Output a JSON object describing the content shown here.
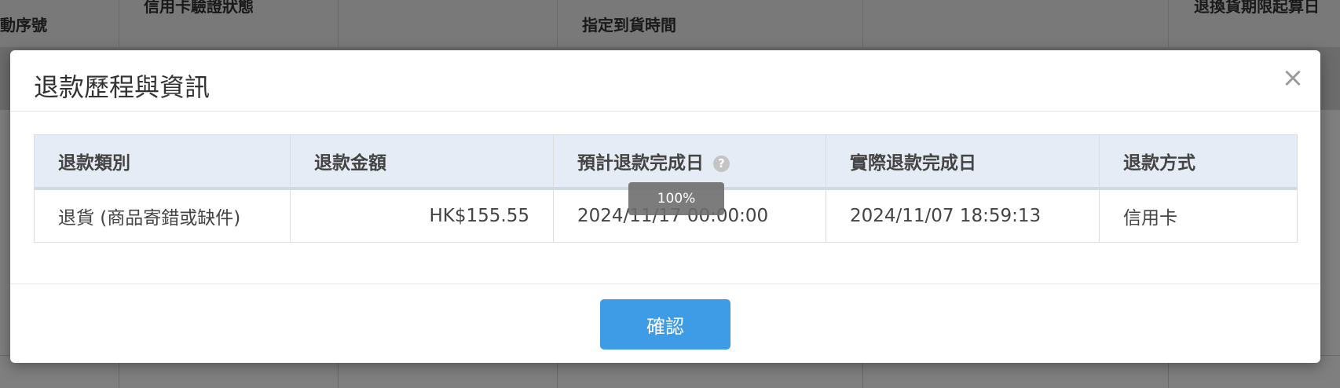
{
  "background": {
    "headers": [
      "動序號",
      "信用卡驗證狀態",
      "",
      "指定到貨時間",
      "",
      "退換貨期限起算日"
    ]
  },
  "modal": {
    "title": "退款歷程與資訊",
    "close_label": "×",
    "table": {
      "columns": [
        "退款類別",
        "退款金額",
        "預計退款完成日",
        "實際退款完成日",
        "退款方式"
      ],
      "rows": [
        {
          "type": "退貨 (商品寄錯或缺件)",
          "amount": "HK$155.55",
          "expected_date": "2024/11/17 00:00:00",
          "actual_date": "2024/11/07 18:59:13",
          "method": "信用卡"
        }
      ]
    },
    "help_icon_glyph": "?",
    "zoom_indicator": "100%",
    "confirm_label": "確認"
  },
  "colors": {
    "accent": "#3e9be6",
    "table_header_bg": "#e6ecf5"
  }
}
